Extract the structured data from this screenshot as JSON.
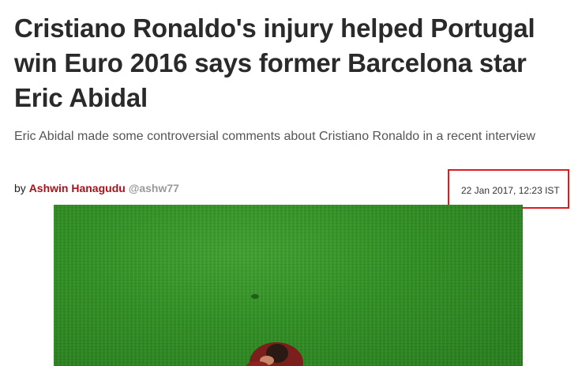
{
  "article": {
    "headline": "Cristiano Ronaldo's injury helped Portugal win Euro 2016 says former Barcelona star Eric Abidal",
    "subheadline": "Eric Abidal made some controversial comments about Cristiano Ronaldo in a recent interview",
    "byline": {
      "prefix": "by",
      "author": "Ashwin Hanagudu",
      "handle": "@ashw77"
    },
    "timestamp": "22 Jan 2017, 12:23 IST"
  },
  "colors": {
    "author_link": "#a8121a",
    "handle": "#9a9a9a",
    "highlight_box": "#e01b1b",
    "pitch_green": "#2f8e22"
  }
}
